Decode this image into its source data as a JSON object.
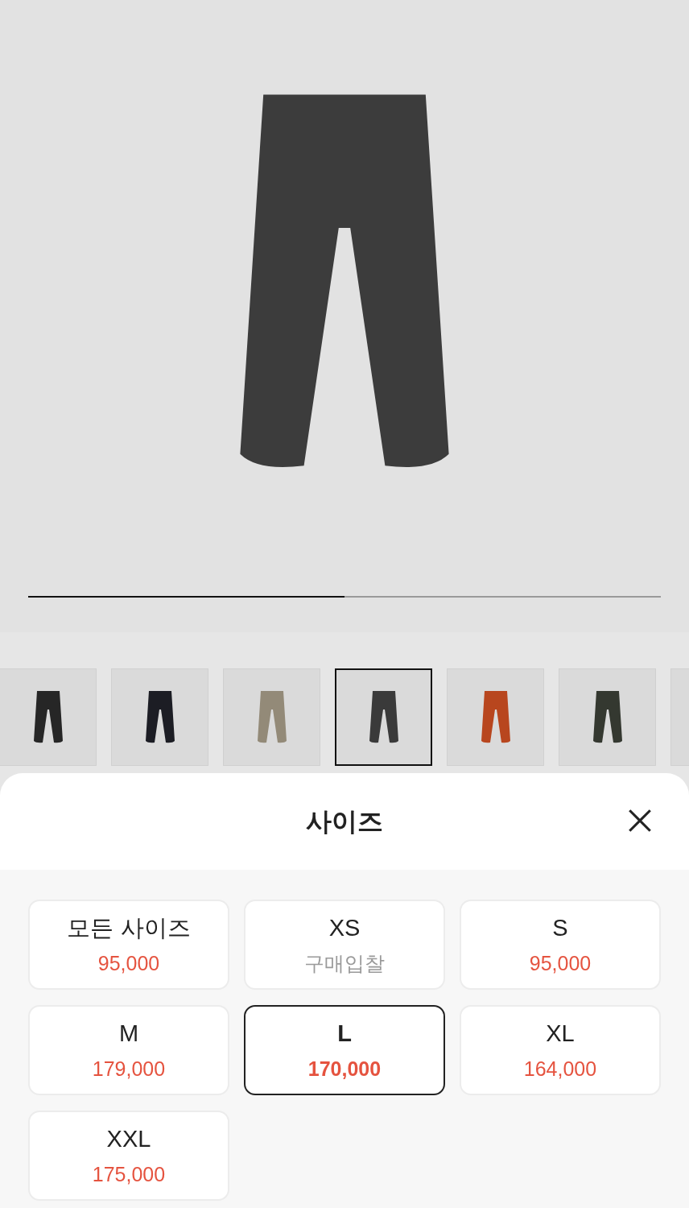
{
  "gallery": {
    "progress": {
      "level": 0.5
    }
  },
  "thumbnails": [
    {
      "color": "#262626",
      "selected": false
    },
    {
      "color": "#1c1d24",
      "selected": false
    },
    {
      "color": "#938a78",
      "selected": false
    },
    {
      "color": "#3a3a3a",
      "selected": true
    },
    {
      "color": "#b8461e",
      "selected": false
    },
    {
      "color": "#343830",
      "selected": false
    },
    {
      "selected": false
    }
  ],
  "sheet": {
    "title": "사이즈",
    "sizes": [
      {
        "label": "모든 사이즈",
        "price": "95,000",
        "kind": "price",
        "selected": false
      },
      {
        "label": "XS",
        "price": "구매입찰",
        "kind": "bid",
        "selected": false
      },
      {
        "label": "S",
        "price": "95,000",
        "kind": "price",
        "selected": false
      },
      {
        "label": "M",
        "price": "179,000",
        "kind": "price",
        "selected": false
      },
      {
        "label": "L",
        "price": "170,000",
        "kind": "price",
        "selected": true
      },
      {
        "label": "XL",
        "price": "164,000",
        "kind": "price",
        "selected": false
      },
      {
        "label": "XXL",
        "price": "175,000",
        "kind": "price",
        "selected": false
      }
    ]
  }
}
